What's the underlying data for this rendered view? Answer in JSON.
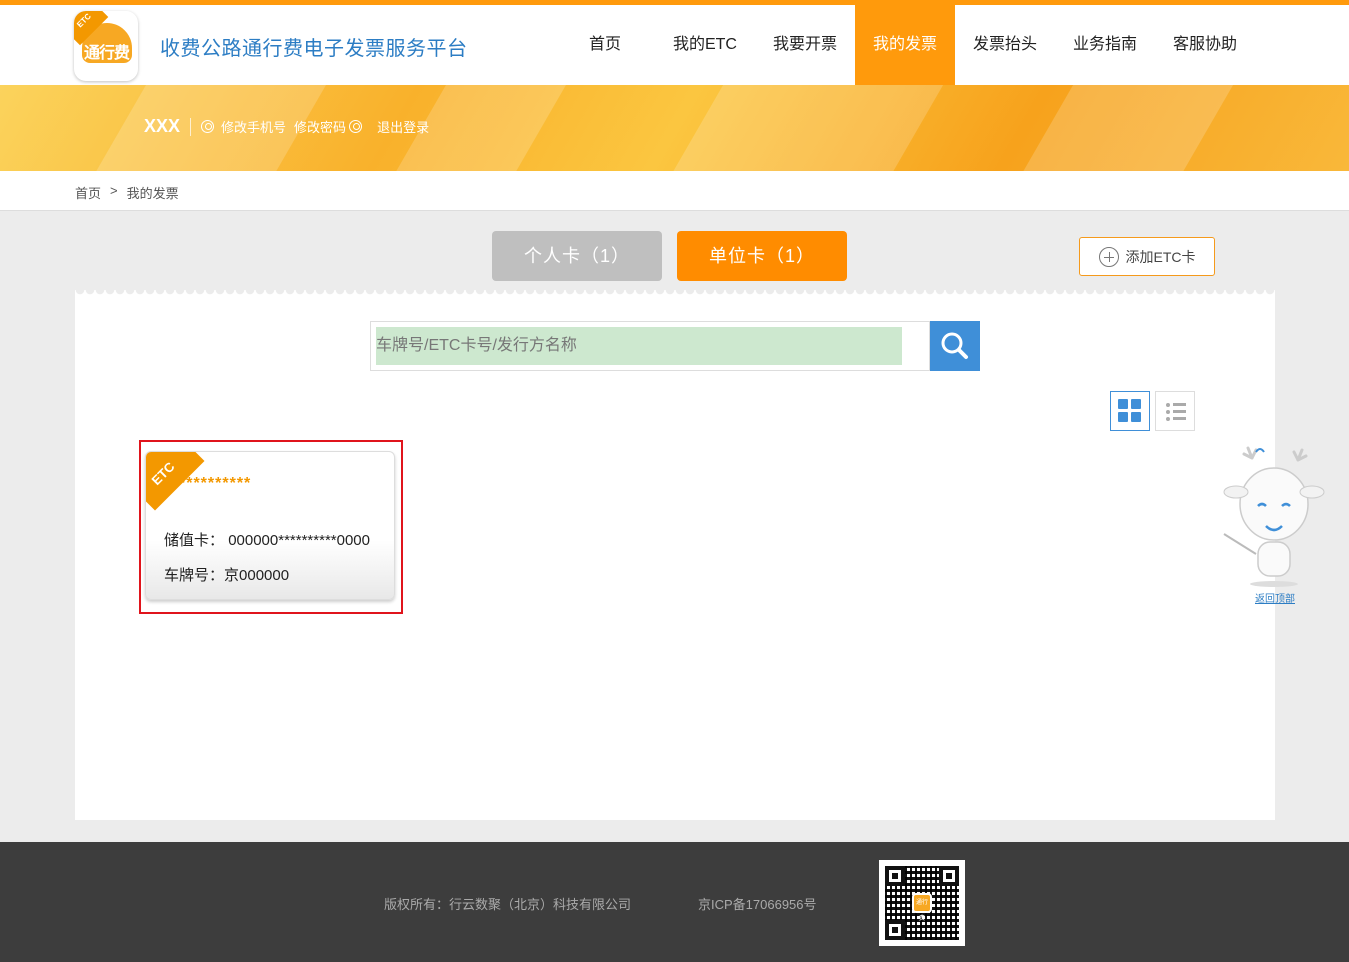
{
  "header": {
    "logo_text": "通行费",
    "logo_badge": "ETC",
    "title": "收费公路通行费电子发票服务平台",
    "nav": [
      {
        "label": "首页"
      },
      {
        "label": "我的ETC"
      },
      {
        "label": "我要开票"
      },
      {
        "label": "我的发票",
        "active": true
      },
      {
        "label": "发票抬头"
      },
      {
        "label": "业务指南"
      },
      {
        "label": "客服协助"
      }
    ],
    "accent_color": "#ff9a0c"
  },
  "user": {
    "name": "XXX",
    "links": [
      {
        "label": "修改手机号"
      },
      {
        "label": "修改密码"
      },
      {
        "label": "退出登录"
      }
    ]
  },
  "breadcrumb": {
    "home": "首页",
    "separator": ">",
    "current": "我的发票"
  },
  "tabs": {
    "personal": "个人卡（1）",
    "unit": "单位卡（1）",
    "active": "unit"
  },
  "add_etc_label": "添加ETC卡",
  "search": {
    "placeholder": "车牌号/ETC卡号/发行方名称",
    "value": ""
  },
  "view_mode": "grid",
  "cards": [
    {
      "badge": "ETC",
      "name": "**********",
      "card_type_label": "储值卡：",
      "card_number": "000000**********0000",
      "plate_label": "车牌号：",
      "plate": "京000000",
      "selected": true
    }
  ],
  "back_to_top": "返回顶部",
  "footer": {
    "copyright": "版权所有：行云数聚（北京）科技有限公司",
    "icp": "京ICP备17066956号",
    "qr_logo": "通行费"
  }
}
